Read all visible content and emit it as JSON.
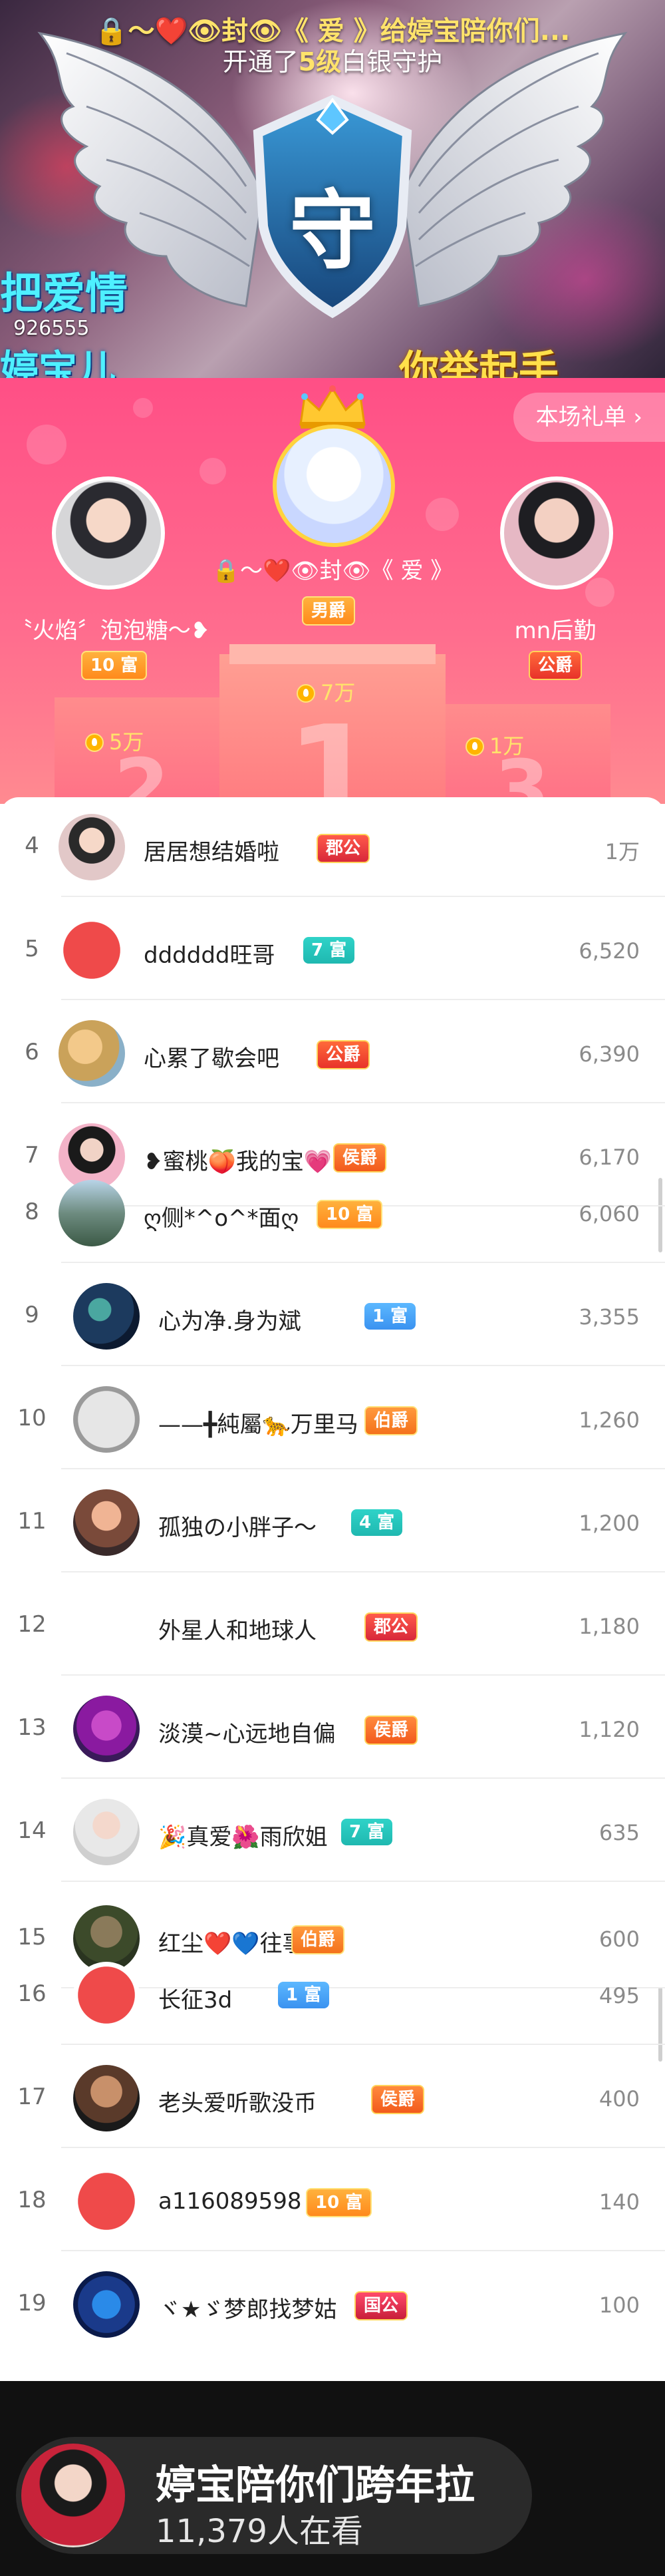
{
  "banner": {
    "line1": "🔒～❤️👁封👁《 爱 》给婷宝陪你们...",
    "line2_pre": "开通了",
    "line2_level": "5级",
    "line2_post": "白银守护",
    "guard_glyph": "守",
    "bg_text_left": "把爱情",
    "bg_text_left2": "婷宝儿",
    "bg_text_num": "926555",
    "bg_text_right": "你举起手"
  },
  "podium": {
    "gift_list_button": "本场礼单 ›",
    "first": {
      "name": "🔒～❤️👁封👁《 爱 》",
      "badge": "男爵",
      "score": "7万",
      "rank": "1"
    },
    "second": {
      "name": "〝火焰〞泡泡糖～❥",
      "badge": "10 富",
      "score": "5万",
      "rank": "2"
    },
    "third": {
      "name": "mn后勤",
      "badge": "公爵",
      "score": "1万",
      "rank": "3"
    }
  },
  "list": [
    {
      "rank": "4",
      "name": "居居想结婚啦",
      "tag": "郡公",
      "tag_class": "t-county",
      "score": "1万"
    },
    {
      "rank": "5",
      "name": "dddddd旺哥",
      "tag": "7 富",
      "tag_class": "t-rich",
      "score": "6,520"
    },
    {
      "rank": "6",
      "name": "心累了歇会吧",
      "tag": "公爵",
      "tag_class": "t-duke",
      "score": "6,390"
    },
    {
      "rank": "7",
      "name": "❥蜜桃🍑我的宝💗",
      "tag": "侯爵",
      "tag_class": "t-marquis",
      "score": "6,170"
    },
    {
      "rank": "8",
      "name": "ღ侧*^o^*面ღ",
      "tag": "10 富",
      "tag_class": "t-rich-gold",
      "score": "6,060"
    },
    {
      "rank": "9",
      "name": "心为净.身为斌",
      "tag": "1 富",
      "tag_class": "t-rich-blue",
      "score": "3,355"
    },
    {
      "rank": "10",
      "name": "——╋純屬🐆万里马",
      "tag": "伯爵",
      "tag_class": "t-earl",
      "score": "1,260"
    },
    {
      "rank": "11",
      "name": "孤独の小胖子〜",
      "tag": "4 富",
      "tag_class": "t-rich",
      "score": "1,200"
    },
    {
      "rank": "12",
      "name": "外星人和地球人",
      "tag": "郡公",
      "tag_class": "t-county",
      "score": "1,180"
    },
    {
      "rank": "13",
      "name": "淡漠~心远地自偏",
      "tag": "侯爵",
      "tag_class": "t-marquis",
      "score": "1,120"
    },
    {
      "rank": "14",
      "name": "🎉真爱🌺雨欣姐",
      "tag": "7 富",
      "tag_class": "t-rich",
      "score": "635"
    },
    {
      "rank": "15",
      "name": "红尘❤️💙往事",
      "tag": "伯爵",
      "tag_class": "t-earl",
      "score": "600"
    },
    {
      "rank": "16",
      "name": "长征3d",
      "tag": "1 富",
      "tag_class": "t-rich-blue",
      "score": "495"
    },
    {
      "rank": "17",
      "name": "老头爱听歌没币",
      "tag": "侯爵",
      "tag_class": "t-marquis",
      "score": "400"
    },
    {
      "rank": "18",
      "name": "a116089598",
      "tag": "10 富",
      "tag_class": "t-rich-gold",
      "score": "140"
    },
    {
      "rank": "19",
      "name": "ヾ★ゞ梦郎找梦姑",
      "tag": "国公",
      "tag_class": "t-state",
      "score": "100"
    }
  ],
  "live": {
    "title": "婷宝陪你们跨年拉",
    "viewers": "11,379人在看"
  }
}
